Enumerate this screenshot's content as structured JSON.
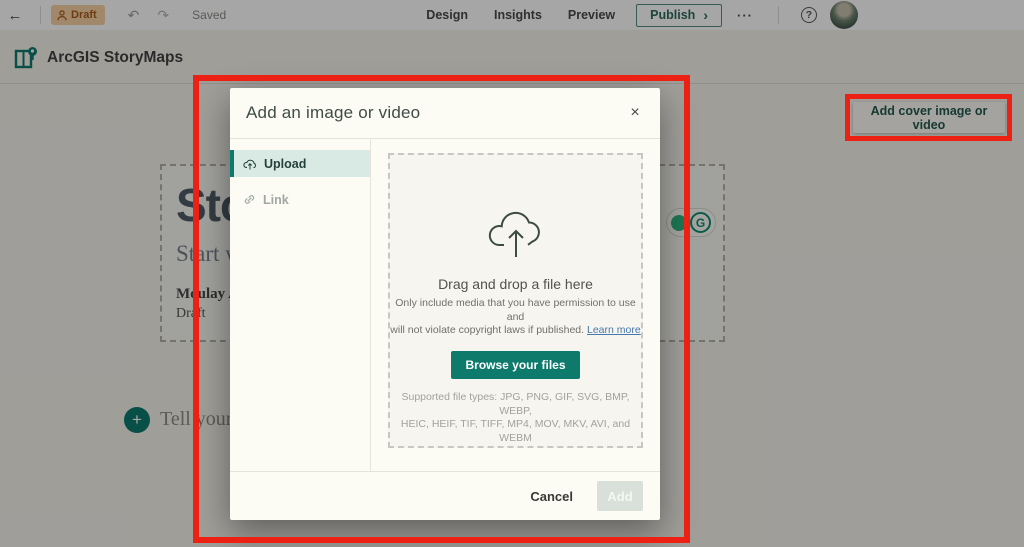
{
  "topbar": {
    "draft_badge": "Draft",
    "saved_label": "Saved",
    "nav": [
      "Design",
      "Insights",
      "Preview"
    ],
    "publish_label": "Publish",
    "icons": {
      "back": "←",
      "undo": "↶",
      "redo": "↷",
      "more": "···",
      "help": "?",
      "chevron": "›"
    }
  },
  "app_header": {
    "brand": "ArcGIS StoryMaps"
  },
  "story": {
    "title_fragment": "Sto",
    "subtitle_fragment": "Start w",
    "author_fragment": "Moulay An",
    "status": "Draft",
    "body_placeholder_fragment": "Tell your s",
    "plus_glyph": "+",
    "grammarly_letter": "G",
    "add_cover_button": "Add cover image or video"
  },
  "modal": {
    "title": "Add an image or video",
    "close_glyph": "×",
    "tabs": [
      {
        "label": "Upload",
        "selected": true
      },
      {
        "label": "Link",
        "selected": false
      }
    ],
    "dropzone": {
      "heading": "Drag and drop a file here",
      "permission_line1": "Only include media that you have permission to use and",
      "permission_line2": "will not violate copyright laws if published.",
      "learn_more": "Learn more",
      "browse_button": "Browse your files",
      "supported_line1": "Supported file types: JPG, PNG, GIF, SVG, BMP, WEBP,",
      "supported_line2": "HEIC, HEIF, TIF, TIFF, MP4, MOV, MKV, AVI, and WEBM"
    },
    "footer": {
      "cancel": "Cancel",
      "add": "Add"
    }
  },
  "colors": {
    "brand_teal": "#0c7a6e",
    "modal_bg": "#fcfbf4",
    "annotation_red": "#ec2113",
    "draft_badge_bg": "#f7d1a3",
    "selected_tab_bg": "#d8eae3"
  }
}
